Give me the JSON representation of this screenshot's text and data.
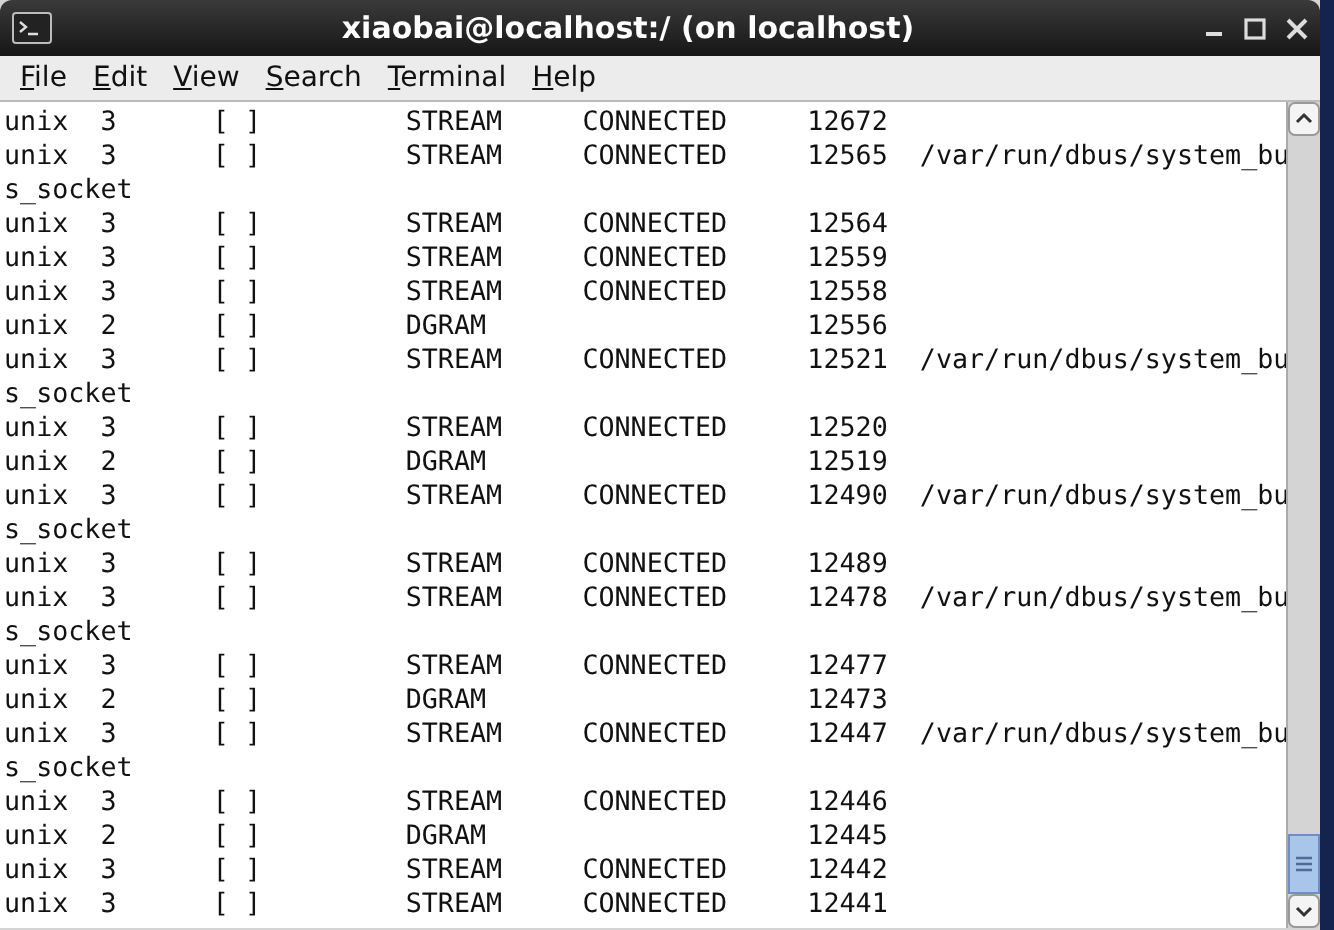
{
  "window": {
    "title": "xiaobai@localhost:/ (on localhost)"
  },
  "menu": [
    "File",
    "Edit",
    "View",
    "Search",
    "Terminal",
    "Help"
  ],
  "terminal": {
    "lines": [
      "unix  3      [ ]         STREAM     CONNECTED     12672",
      "unix  3      [ ]         STREAM     CONNECTED     12565  /var/run/dbus/system_bu",
      "s_socket",
      "unix  3      [ ]         STREAM     CONNECTED     12564",
      "unix  3      [ ]         STREAM     CONNECTED     12559",
      "unix  3      [ ]         STREAM     CONNECTED     12558",
      "unix  2      [ ]         DGRAM                    12556",
      "unix  3      [ ]         STREAM     CONNECTED     12521  /var/run/dbus/system_bu",
      "s_socket",
      "unix  3      [ ]         STREAM     CONNECTED     12520",
      "unix  2      [ ]         DGRAM                    12519",
      "unix  3      [ ]         STREAM     CONNECTED     12490  /var/run/dbus/system_bu",
      "s_socket",
      "unix  3      [ ]         STREAM     CONNECTED     12489",
      "unix  3      [ ]         STREAM     CONNECTED     12478  /var/run/dbus/system_bu",
      "s_socket",
      "unix  3      [ ]         STREAM     CONNECTED     12477",
      "unix  2      [ ]         DGRAM                    12473",
      "unix  3      [ ]         STREAM     CONNECTED     12447  /var/run/dbus/system_bu",
      "s_socket",
      "unix  3      [ ]         STREAM     CONNECTED     12446",
      "unix  2      [ ]         DGRAM                    12445",
      "unix  3      [ ]         STREAM     CONNECTED     12442",
      "unix  3      [ ]         STREAM     CONNECTED     12441"
    ]
  }
}
